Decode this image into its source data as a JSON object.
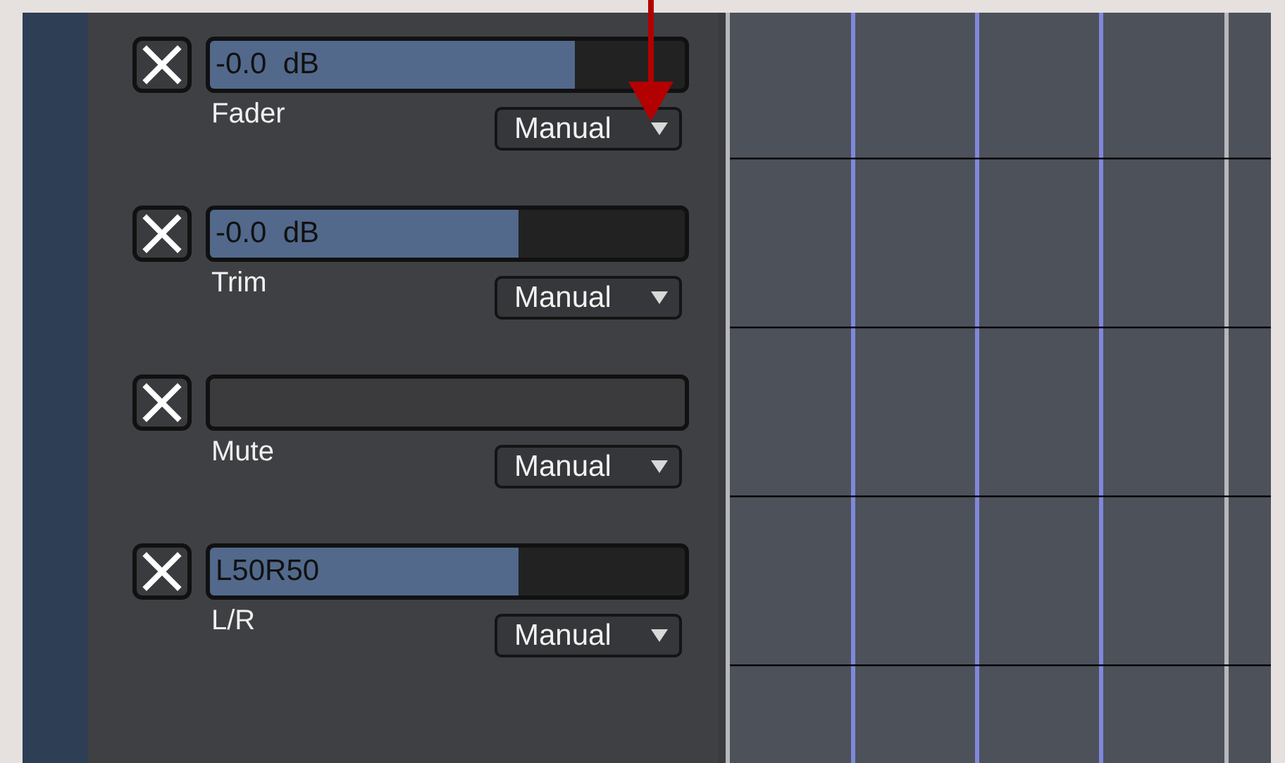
{
  "lanes": [
    {
      "kind": "slider",
      "name": "Fader",
      "value": "-0.0  dB",
      "level": 0.77,
      "mode": "Manual"
    },
    {
      "kind": "slider",
      "name": "Trim",
      "value": "-0.0  dB",
      "level": 0.65,
      "mode": "Manual"
    },
    {
      "kind": "toggle",
      "name": "Mute",
      "on": false,
      "mode": "Manual"
    },
    {
      "kind": "slider",
      "name": "L/R",
      "value": "L50R50",
      "level": 0.65,
      "mode": "Manual"
    }
  ]
}
